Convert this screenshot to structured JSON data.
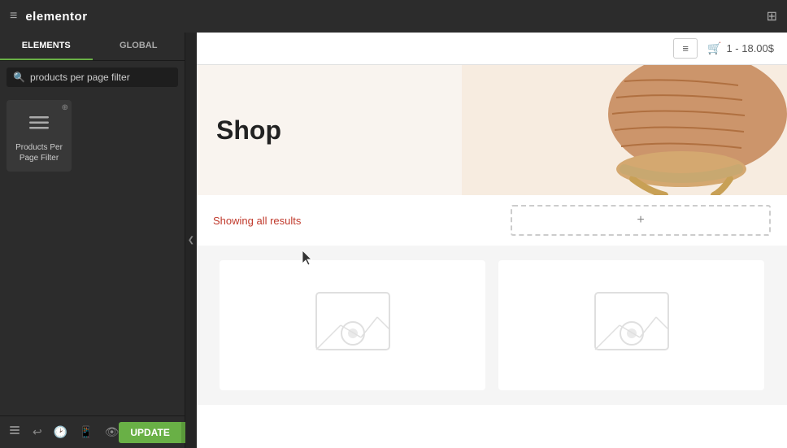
{
  "topbar": {
    "app_title": "elementor",
    "hamburger_symbol": "≡",
    "grid_symbol": "⊞"
  },
  "sidebar": {
    "tabs": [
      {
        "label": "ELEMENTS",
        "active": true
      },
      {
        "label": "GLOBAL",
        "active": false
      }
    ],
    "search": {
      "placeholder": "products per page filter",
      "value": "products per page filter"
    },
    "widgets": [
      {
        "label": "Products Per Page Filter",
        "icon_symbol": "☰"
      }
    ]
  },
  "canvas": {
    "filter_icon": "≡",
    "cart_text": "1 - 18.00$",
    "cart_icon": "🛒",
    "shop_title": "Shop",
    "showing_results": "Showing all results",
    "add_section_symbol": "+"
  },
  "bottom_toolbar": {
    "update_label": "UPDATE",
    "arrow_symbol": "▲",
    "icons": [
      "layers",
      "undo",
      "history",
      "responsive",
      "hide"
    ]
  }
}
